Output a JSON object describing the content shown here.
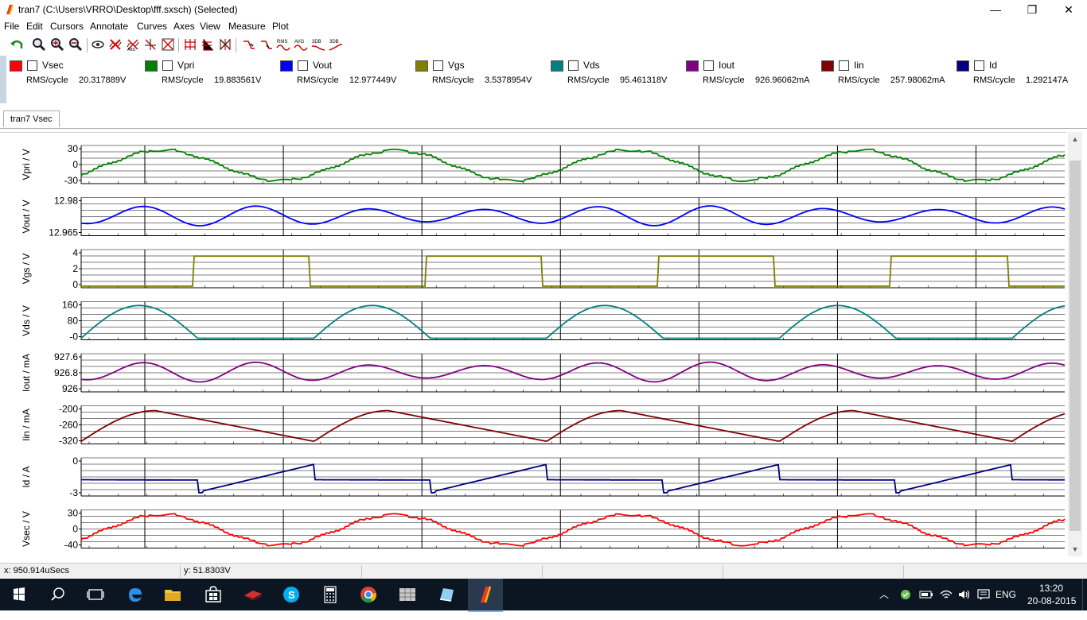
{
  "window": {
    "title": "tran7 (C:\\Users\\VRRO\\Desktop\\fff.sxsch) (Selected)",
    "minimize": "—",
    "maximize": "❐",
    "close": "✕"
  },
  "menu": [
    "File",
    "Edit",
    "Cursors",
    "Annotate",
    "Curves",
    "Axes",
    "View",
    "Measure",
    "Plot"
  ],
  "toolbar": {
    "rms": "RMS",
    "avg": "AVG",
    "db1": "3DB",
    "db2": "3DB"
  },
  "legend": [
    {
      "name": "Vsec",
      "color": "#ff0000",
      "label": "RMS/cycle",
      "value": "20.317889V"
    },
    {
      "name": "Vpri",
      "color": "#008000",
      "label": "RMS/cycle",
      "value": "19.883561V"
    },
    {
      "name": "Vout",
      "color": "#0000ff",
      "label": "RMS/cycle",
      "value": "12.977449V"
    },
    {
      "name": "Vgs",
      "color": "#808000",
      "label": "RMS/cycle",
      "value": "3.5378954V"
    },
    {
      "name": "Vds",
      "color": "#008080",
      "label": "RMS/cycle",
      "value": "95.461318V"
    },
    {
      "name": "Iout",
      "color": "#800080",
      "label": "RMS/cycle",
      "value": "926.96062mA"
    },
    {
      "name": "Iin",
      "color": "#800000",
      "label": "RMS/cycle",
      "value": "257.98062mA"
    },
    {
      "name": "Id",
      "color": "#000080",
      "label": "RMS/cycle",
      "value": "1.292147A"
    }
  ],
  "tab": "tran7 Vsec",
  "chart_data": {
    "type": "line",
    "grid": true,
    "panels": [
      {
        "ylabel": "Vpri / V",
        "ticks": [
          "30",
          "0",
          "-30"
        ],
        "color": "#008000",
        "kind": "wave",
        "ylim": [
          -30,
          30
        ]
      },
      {
        "ylabel": "Vout / V",
        "ticks": [
          "12.98",
          "12.965"
        ],
        "color": "#0000ff",
        "kind": "ripple",
        "ylim": [
          12.965,
          12.98
        ]
      },
      {
        "ylabel": "Vgs / V",
        "ticks": [
          "4",
          "2",
          "0"
        ],
        "color": "#808000",
        "kind": "square",
        "ylim": [
          0,
          5
        ]
      },
      {
        "ylabel": "Vds / V",
        "ticks": [
          "160",
          "80",
          "-0"
        ],
        "color": "#008080",
        "kind": "arch",
        "ylim": [
          0,
          200
        ]
      },
      {
        "ylabel": "Iout / mA",
        "ticks": [
          "927.6",
          "926.8",
          "926"
        ],
        "color": "#800080",
        "kind": "ripple",
        "ylim": [
          926,
          927.6
        ]
      },
      {
        "ylabel": "Iin / mA",
        "ticks": [
          "-200",
          "-260",
          "-320"
        ],
        "color": "#800000",
        "kind": "tri",
        "ylim": [
          -320,
          -200
        ]
      },
      {
        "ylabel": "Id / A",
        "ticks": [
          "0",
          "-3"
        ],
        "color": "#000080",
        "kind": "ramp",
        "ylim": [
          -3,
          3
        ]
      },
      {
        "ylabel": "Vsec / V",
        "ticks": [
          "30",
          "0",
          "-40"
        ],
        "color": "#ff0000",
        "kind": "wave",
        "ylim": [
          -40,
          30
        ]
      }
    ]
  },
  "status": {
    "x": "x: 950.914uSecs",
    "y": "y: 51.8303V"
  },
  "taskbar": {
    "lang": "ENG",
    "time": "13:20",
    "date": "20-08-2015"
  }
}
